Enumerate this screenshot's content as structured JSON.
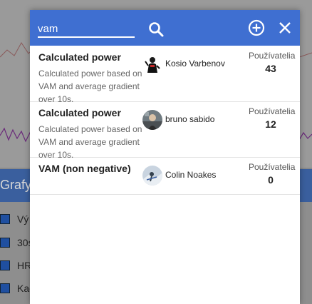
{
  "background": {
    "section_title": "Grafy",
    "list_items": [
      "Vý",
      "30s",
      "HR",
      "Kad"
    ]
  },
  "search": {
    "value": "vam",
    "placeholder": ""
  },
  "icons": {
    "search": "search-icon",
    "add": "add-circle-icon",
    "close": "close-icon"
  },
  "colors": {
    "header": "#3f6fd1",
    "background_bar": "#3a5f9e"
  },
  "results": [
    {
      "title": "Calculated power",
      "description": "Calculated power based on VAM and average gradient over 10s.",
      "author": "Kosio Varbenov",
      "users_label": "Používatelia",
      "users_count": "43"
    },
    {
      "title": "Calculated power",
      "description": "Calculated power based on VAM and average gradient over 10s.",
      "author": "bruno sabido",
      "users_label": "Používatelia",
      "users_count": "12"
    },
    {
      "title": "VAM (non negative)",
      "description": "",
      "author": "Colin Noakes",
      "users_label": "Používatelia",
      "users_count": "0"
    }
  ]
}
